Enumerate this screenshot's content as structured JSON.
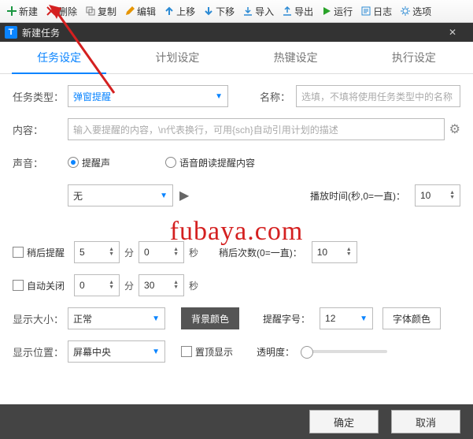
{
  "toolbar": [
    {
      "name": "new",
      "label": "新建",
      "color": "#1a9641"
    },
    {
      "name": "delete",
      "label": "删除",
      "color": "#d42020"
    },
    {
      "name": "copy",
      "label": "复制",
      "color": "#7a7a7a"
    },
    {
      "name": "edit",
      "label": "编辑",
      "color": "#e69500"
    },
    {
      "name": "moveup",
      "label": "上移",
      "color": "#2b8ad4"
    },
    {
      "name": "movedown",
      "label": "下移",
      "color": "#2b8ad4"
    },
    {
      "name": "import",
      "label": "导入",
      "color": "#2b8ad4"
    },
    {
      "name": "export",
      "label": "导出",
      "color": "#2b8ad4"
    },
    {
      "name": "run",
      "label": "运行",
      "color": "#29a329"
    },
    {
      "name": "log",
      "label": "日志",
      "color": "#2b8ad4"
    },
    {
      "name": "options",
      "label": "选项",
      "color": "#2b8ad4"
    }
  ],
  "window": {
    "title": "新建任务"
  },
  "tabs": {
    "items": [
      "任务设定",
      "计划设定",
      "热键设定",
      "执行设定"
    ],
    "active": 0
  },
  "form": {
    "task_type_label": "任务类型：",
    "task_type_value": "弹窗提醒",
    "name_label": "名称：",
    "name_placeholder": "选填，不填将使用任务类型中的名称",
    "content_label": "内容：",
    "content_placeholder": "输入要提醒的内容，\\n代表换行，可用{sch}自动引用计划的描述",
    "sound_label": "声音：",
    "radio_sound": "提醒声",
    "radio_tts": "语音朗读提醒内容",
    "sound_value": "无",
    "play_time_label": "播放时间(秒,0=一直)：",
    "play_time_value": "10",
    "later_label": "稍后提醒",
    "later_min": "5",
    "later_sec": "0",
    "later_unit_min": "分",
    "later_unit_sec": "秒",
    "later_count_label": "稍后次数(0=一直)：",
    "later_count_value": "10",
    "autoclose_label": "自动关闭",
    "autoclose_min": "0",
    "autoclose_sec": "30",
    "size_label": "显示大小：",
    "size_value": "正常",
    "bgcolor_btn": "背景颜色",
    "fontsize_label": "提醒字号：",
    "fontsize_value": "12",
    "fontcolor_btn": "字体颜色",
    "position_label": "显示位置：",
    "position_value": "屏幕中央",
    "topmost_label": "置顶显示",
    "opacity_label": "透明度："
  },
  "footer": {
    "ok": "确定",
    "cancel": "取消"
  },
  "watermark": "fubaya.com"
}
